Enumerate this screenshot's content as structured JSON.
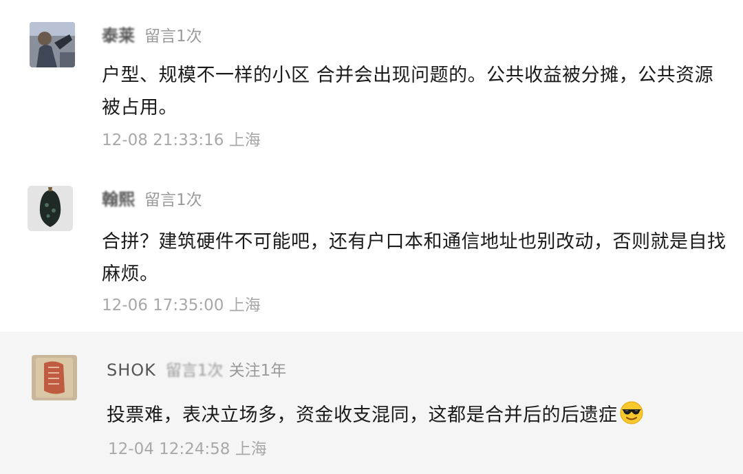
{
  "comments": [
    {
      "username": "泰莱",
      "count": "留言1次",
      "content": "户型、规模不一样的小区 合并会出现问题的。公共收益被分摊，公共资源被占用。",
      "time": "12-08 21:33:16 上海"
    },
    {
      "username": "翰熙",
      "count": "留言1次",
      "content": "合拼？建筑硬件不可能吧，还有户口本和通信地址也别改动，否则就是自找麻烦。",
      "time": "12-06 17:35:00 上海"
    },
    {
      "username": "SHOK",
      "count": "留言1次",
      "follow": "关注1年",
      "content": "投票难，表决立场多，资金收支混同，这都是合并后的后遗症",
      "time": "12-04 12:24:58 上海"
    }
  ],
  "icons": {
    "emoji": "cool-sunglasses-emoji"
  },
  "colors": {
    "highlight_bg": "#f5f5f5",
    "meta_gray": "#9a9a9a",
    "time_gray": "#a8a8a8",
    "content": "#1a1a1a"
  }
}
